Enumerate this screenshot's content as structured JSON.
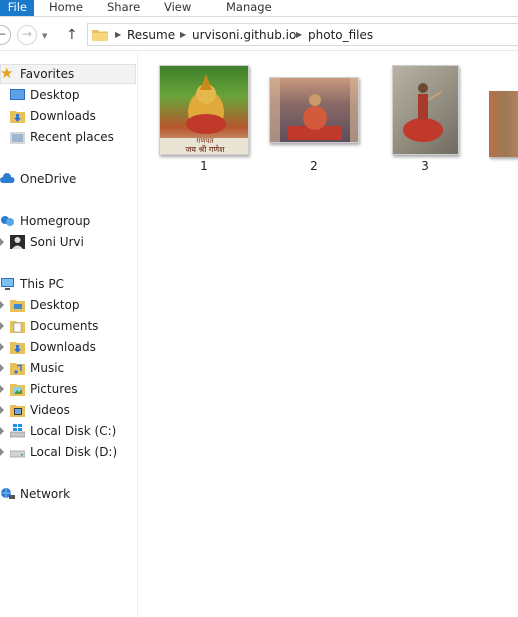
{
  "ribbon": {
    "tabs": [
      "File",
      "Home",
      "Share",
      "View",
      "Manage"
    ]
  },
  "navigation": {
    "back_icon": "back-arrow-icon",
    "forward_icon": "forward-arrow-icon",
    "up_icon": "up-arrow-icon"
  },
  "address": {
    "crumbs": [
      "Resume",
      "urvisoni.github.io",
      "photo_files"
    ]
  },
  "navpane": {
    "favorites": {
      "label": "Favorites",
      "items": [
        "Desktop",
        "Downloads",
        "Recent places"
      ]
    },
    "onedrive": "OneDrive",
    "homegroup": {
      "label": "Homegroup",
      "items": [
        "Soni Urvi"
      ]
    },
    "thispc": {
      "label": "This PC",
      "items": [
        "Desktop",
        "Documents",
        "Downloads",
        "Music",
        "Pictures",
        "Videos",
        "Local Disk (C:)",
        "Local Disk (D:)"
      ]
    },
    "network": "Network"
  },
  "files": [
    {
      "name": "1",
      "thumb_text": [
        "गणपत",
        "जय श्री गणेश"
      ]
    },
    {
      "name": "2"
    },
    {
      "name": "3"
    },
    {
      "name": ""
    }
  ],
  "colors": {
    "file_tab": "#1979ca",
    "folder": "#e8c15a",
    "selection": "#f3f3f3"
  }
}
